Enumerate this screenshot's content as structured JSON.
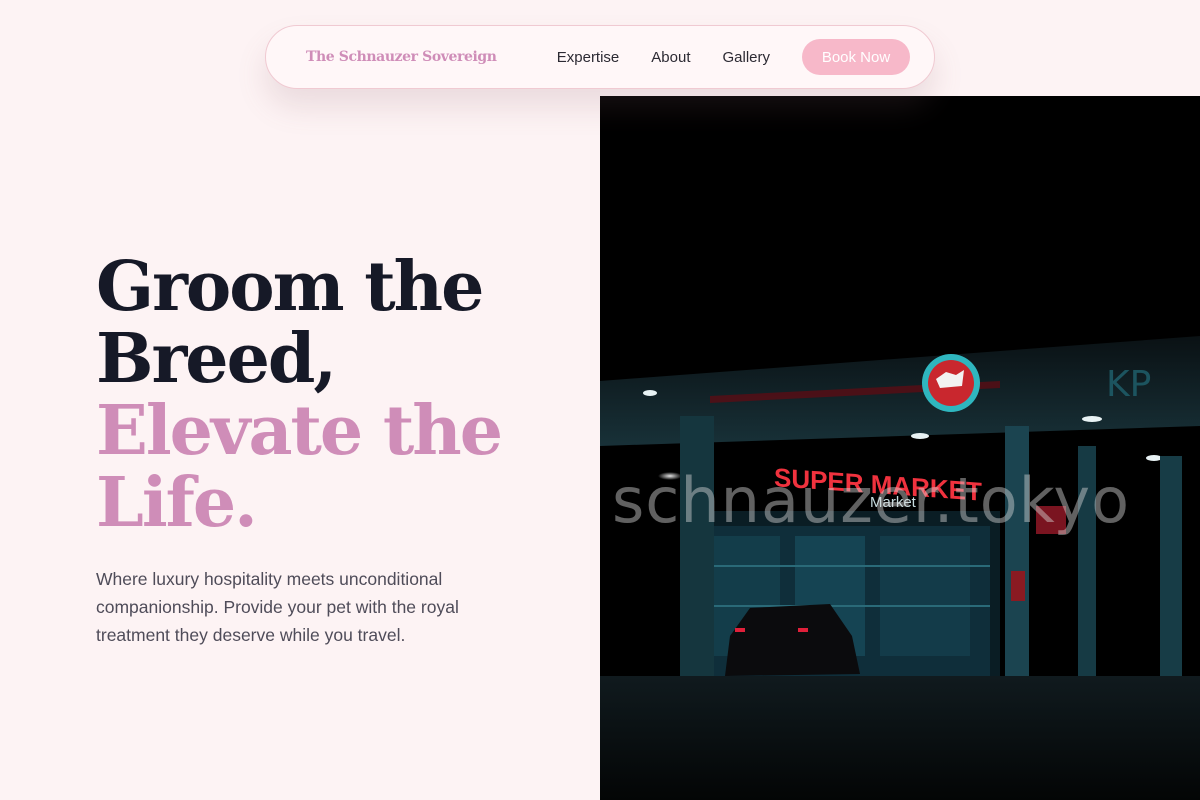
{
  "nav": {
    "brand": "The Schnauzer Sovereign",
    "links": [
      {
        "label": "Expertise"
      },
      {
        "label": "About"
      },
      {
        "label": "Gallery"
      }
    ],
    "cta": "Book Now"
  },
  "hero": {
    "headline_lines": [
      "Groom the",
      "Breed,"
    ],
    "headline_accent_lines": [
      "Elevate the",
      "Life."
    ],
    "lede": "Where luxury hospitality meets unconditional companionship. Provide your pet with the royal treatment they deserve while you travel."
  },
  "photo": {
    "watermark": "schnauzer.tokyo",
    "sign_text": "SUPER MARKET",
    "sub_sign_text": "Market",
    "corner_sign_text": "KP"
  },
  "colors": {
    "background": "#fdf3f4",
    "accent": "#cf8db8",
    "button": "#f7b8c9",
    "headline": "#161927"
  }
}
